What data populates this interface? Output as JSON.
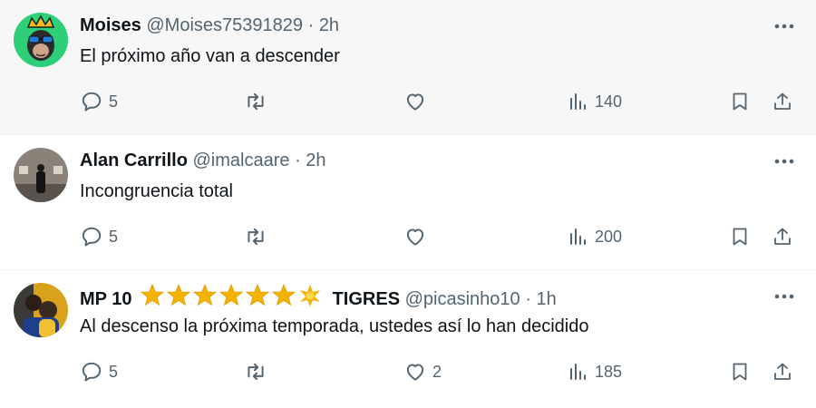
{
  "tweets": [
    {
      "name": "Moises",
      "handle": "@Moises75391829",
      "dot": "·",
      "time": "2h",
      "text": "El próximo año van a descender",
      "replies": "5",
      "retweets": "",
      "likes": "",
      "views": "140",
      "avatar_icon": "crowned-ape-avatar",
      "avatar_bg": "#2fcf7a"
    },
    {
      "name": "Alan Carrillo",
      "handle": "@imalcaare",
      "dot": "·",
      "time": "2h",
      "text": "Incongruencia total",
      "replies": "5",
      "retweets": "",
      "likes": "",
      "views": "200",
      "avatar_icon": "gallery-person-avatar",
      "avatar_bg": "#8a8178"
    },
    {
      "name": "MP 10",
      "name_suffix": "TIGRES",
      "stars": "★★★★★★✹",
      "handle": "@picasinho10",
      "dot": "·",
      "time": "1h",
      "text": "Al descenso la próxima temporada, ustedes así lo han decidido",
      "replies": "5",
      "retweets": "",
      "likes": "2",
      "views": "185",
      "avatar_icon": "player-photo-avatar",
      "avatar_bg": "#d9a21c"
    }
  ],
  "icons": {
    "more": "more-horizontal-icon",
    "reply": "reply-bubble-icon",
    "retweet": "retweet-icon",
    "like": "heart-icon",
    "views": "views-bar-chart-icon",
    "bookmark": "bookmark-icon",
    "share": "share-upload-icon"
  },
  "colors": {
    "text": "#0f1419",
    "muted": "#536471",
    "hover_bg": "#f7f7f7",
    "divider": "#eff3f4",
    "star": "#f5b301"
  }
}
